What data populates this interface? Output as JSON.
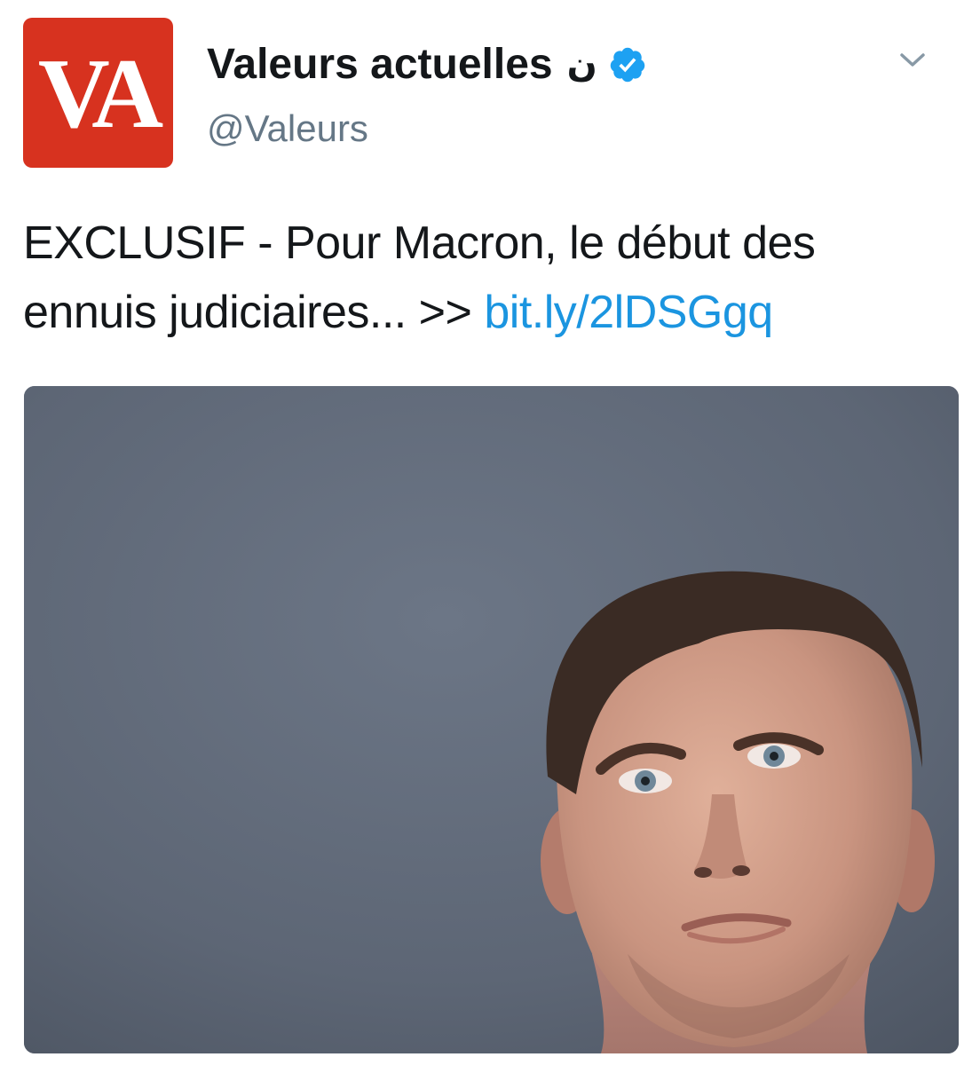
{
  "tweet": {
    "avatar": {
      "text": "VA",
      "color": "#d7321f"
    },
    "display_name": "Valeurs actuelles",
    "name_suffix": "ن",
    "verified_icon": "verified-badge-icon",
    "handle": "@Valeurs",
    "caret_icon": "chevron-down-icon",
    "text": "EXCLUSIF - Pour Macron, le début des ennuis judiciaires... >> ",
    "link": "bit.ly/2lDSGgq",
    "media": {
      "icon": "photo-portrait"
    }
  },
  "colors": {
    "link": "#1b95e0",
    "verified": "#1da1f2",
    "text": "#14171a",
    "secondary": "#657786"
  }
}
